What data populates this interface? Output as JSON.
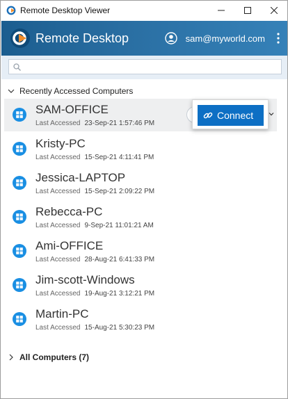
{
  "window": {
    "title": "Remote Desktop Viewer"
  },
  "header": {
    "brand": "Remote Desktop",
    "user_email": "sam@myworld.com"
  },
  "search": {
    "placeholder": "",
    "value": ""
  },
  "recent_section": {
    "label": "Recently Accessed Computers"
  },
  "all_section": {
    "label": "All Computers (7)"
  },
  "last_accessed_label": "Last Accessed",
  "connect_label": "Connect",
  "computers": [
    {
      "name": "SAM-OFFICE",
      "date": "23-Sep-21 1:57:46 PM",
      "os_icon": "windows-icon"
    },
    {
      "name": "Kristy-PC",
      "date": "15-Sep-21 4:11:41 PM",
      "os_icon": "windows-icon"
    },
    {
      "name": "Jessica-LAPTOP",
      "date": "15-Sep-21 2:09:22 PM",
      "os_icon": "windows-icon"
    },
    {
      "name": "Rebecca-PC",
      "date": "9-Sep-21 11:01:21 AM",
      "os_icon": "windows-icon"
    },
    {
      "name": "Ami-OFFICE",
      "date": "28-Aug-21 6:41:33 PM",
      "os_icon": "windows-icon"
    },
    {
      "name": "Jim-scott-Windows",
      "date": "19-Aug-21 3:12:21 PM",
      "os_icon": "windows-icon"
    },
    {
      "name": "Martin-PC",
      "date": "15-Aug-21 5:30:23 PM",
      "os_icon": "windows-icon"
    }
  ],
  "colors": {
    "header_start": "#1b5d8f",
    "header_end": "#3581b8",
    "accent": "#0d6fc4",
    "os_icon": "#1a8fe3"
  }
}
